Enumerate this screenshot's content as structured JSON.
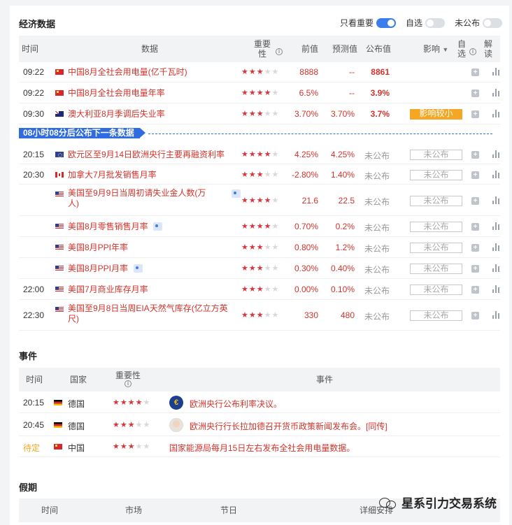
{
  "econ": {
    "title": "经济数据",
    "toggles": [
      {
        "label": "只看重要",
        "on": true
      },
      {
        "label": "自选",
        "on": false
      },
      {
        "label": "未公布",
        "on": false
      }
    ],
    "headers": {
      "time": "时间",
      "data": "数据",
      "importance": "重要性",
      "prev": "前值",
      "forecast": "预测值",
      "actual": "公布值",
      "impact": "影响",
      "watch": "自选",
      "analysis": "解读"
    },
    "countdown": "08小时08分后公布下一条数据",
    "rows": [
      {
        "time": "09:22",
        "flag": "cn",
        "name": "中国8月全社会用电量(亿千瓦时)",
        "stars": 3,
        "prev": "8888",
        "forecast": "--",
        "actual": "8861",
        "impact": "",
        "tag": false
      },
      {
        "time": "09:22",
        "flag": "cn",
        "name": "中国8月全社会用电量年率",
        "stars": 4,
        "prev": "6.5%",
        "forecast": "--",
        "actual": "3.9%",
        "impact": "",
        "tag": false
      },
      {
        "time": "09:30",
        "flag": "au",
        "name": "澳大利亚8月季调后失业率",
        "stars": 3,
        "prev": "3.70%",
        "forecast": "3.70%",
        "actual": "3.7%",
        "impact": "影响较小",
        "tag": false
      },
      {
        "time": "20:15",
        "flag": "eu",
        "name": "欧元区至9月14日欧洲央行主要再融资利率",
        "stars": 4,
        "prev": "4.25%",
        "forecast": "4.25%",
        "actual": "未公布",
        "impact": "未公布",
        "tag": false
      },
      {
        "time": "20:30",
        "flag": "ca",
        "name": "加拿大7月批发销售月率",
        "stars": 3,
        "prev": "-2.80%",
        "forecast": "1.40%",
        "actual": "未公布",
        "impact": "未公布",
        "tag": false
      },
      {
        "time": "",
        "flag": "us",
        "name": "美国至9月9日当周初请失业金人数(万",
        "name2": "人)",
        "stars": 4,
        "prev": "21.6",
        "forecast": "22.5",
        "actual": "未公布",
        "impact": "未公布",
        "tag": true
      },
      {
        "time": "",
        "flag": "us",
        "name": "美国8月零售销售月率",
        "stars": 4,
        "prev": "0.70%",
        "forecast": "0.2%",
        "actual": "未公布",
        "impact": "未公布",
        "tag": true
      },
      {
        "time": "",
        "flag": "us",
        "name": "美国8月PPI年率",
        "stars": 3,
        "prev": "0.80%",
        "forecast": "1.2%",
        "actual": "未公布",
        "impact": "未公布",
        "tag": false
      },
      {
        "time": "",
        "flag": "us",
        "name": "美国8月PPI月率",
        "stars": 3,
        "prev": "0.30%",
        "forecast": "0.40%",
        "actual": "未公布",
        "impact": "未公布",
        "tag": true
      },
      {
        "time": "22:00",
        "flag": "us",
        "name": "美国7月商业库存月率",
        "stars": 3,
        "prev": "0.00%",
        "forecast": "0.10%",
        "actual": "未公布",
        "impact": "未公布",
        "tag": false
      },
      {
        "time": "22:30",
        "flag": "us",
        "name": "美国至9月8日当周EIA天然气库存(亿立方英",
        "name2": "尺)",
        "stars": 3,
        "prev": "330",
        "forecast": "480",
        "actual": "未公布",
        "impact": "未公布",
        "tag": false
      }
    ]
  },
  "events": {
    "title": "事件",
    "headers": {
      "time": "时间",
      "country": "国家",
      "importance": "重要性",
      "event": "事件"
    },
    "rows": [
      {
        "time": "20:15",
        "flag": "de",
        "country": "德国",
        "stars": 4,
        "avatar": "ecb",
        "avatar_text": "€",
        "text": "欧洲央行公布利率决议。"
      },
      {
        "time": "20:45",
        "flag": "de",
        "country": "德国",
        "stars": 3,
        "avatar": "person",
        "avatar_text": "",
        "text": "欧洲央行行长拉加德召开货币政策新闻发布会。[同传]"
      },
      {
        "time": "待定",
        "flag": "cn",
        "country": "中国",
        "stars": 3,
        "avatar": "",
        "avatar_text": "",
        "text": "国家能源局每月15日左右发布全社会用电量数据。"
      }
    ]
  },
  "holidays": {
    "title": "假期",
    "headers": {
      "time": "时间",
      "market": "市场",
      "festival": "节日",
      "detail": "详细安排"
    }
  },
  "watermark": {
    "text": "星系引力交易系统"
  },
  "colors": {
    "accent": "#2f6ce0",
    "red": "#d0342c",
    "impact_small": "#f5a623"
  }
}
